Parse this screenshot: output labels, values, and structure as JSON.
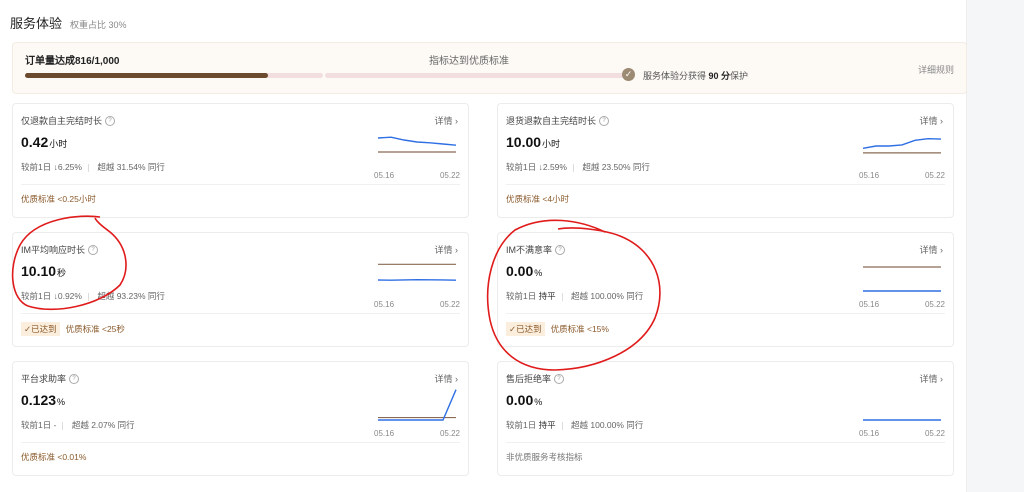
{
  "section": {
    "title": "服务体验",
    "weight": "权重占比 30%"
  },
  "progress": {
    "label": "订单量达成816/1,000",
    "middle": "指标达到优质标准",
    "protect_prefix": "服务体验分获得",
    "protect_score": "90 分",
    "protect_suffix": "保护",
    "rules": "详细规则",
    "orders_done": 816,
    "orders_target": 1000,
    "shield_icon": "shield-check-icon"
  },
  "detail_label": "详情 ›",
  "cards": [
    {
      "title": "仅退款自主完结时长",
      "value": "0.42",
      "unit": "小时",
      "cmp_label": "较前1日",
      "cmp_dir": "↓",
      "cmp_val": "6.25%",
      "beat": "超越 31.54% 同行",
      "achieved": "",
      "standard": "优质标准 <0.25小时",
      "d1": "05.16",
      "d2": "05.22",
      "trend": [
        0.6,
        0.62,
        0.55,
        0.5,
        0.48,
        0.45,
        0.42
      ],
      "baseline": 0.25,
      "ymax": 0.8
    },
    {
      "title": "退货退款自主完结时长",
      "value": "10.00",
      "unit": "小时",
      "cmp_label": "较前1日",
      "cmp_dir": "↓",
      "cmp_val": "2.59%",
      "beat": "超越 23.50% 同行",
      "achieved": "",
      "standard": "优质标准 <4小时",
      "d1": "05.16",
      "d2": "05.22",
      "trend": [
        6,
        7,
        7,
        7.5,
        9.5,
        10.2,
        10
      ],
      "baseline": 4,
      "ymax": 14
    },
    {
      "title": "IM平均响应时长",
      "value": "10.10",
      "unit": "秒",
      "cmp_label": "较前1日",
      "cmp_dir": "↓",
      "cmp_val": "0.92%",
      "beat": "超越 93.23% 同行",
      "achieved": "✓已达到",
      "standard": "优质标准 <25秒",
      "d1": "05.16",
      "d2": "05.22",
      "trend": [
        10.3,
        10.1,
        10.4,
        10.6,
        10.5,
        10.4,
        10.1
      ],
      "baseline": 25,
      "ymax": 30
    },
    {
      "title": "IM不满意率",
      "value": "0.00",
      "unit": "%",
      "cmp_label": "较前1日",
      "cmp_dir": "",
      "cmp_val": "持平",
      "beat": "超越 100.00% 同行",
      "achieved": "✓已达到",
      "standard": "优质标准 <15%",
      "d1": "05.16",
      "d2": "05.22",
      "trend": [
        0,
        0,
        0,
        0,
        0,
        0,
        0
      ],
      "baseline": 15,
      "ymax": 20
    },
    {
      "title": "平台求助率",
      "value": "0.123",
      "unit": "%",
      "cmp_label": "较前1日",
      "cmp_dir": "",
      "cmp_val": "-",
      "beat": "超越 2.07% 同行",
      "achieved": "",
      "standard": "优质标准 <0.01%",
      "d1": "05.16",
      "d2": "05.22",
      "trend": [
        0,
        0,
        0,
        0,
        0,
        0,
        0.123
      ],
      "baseline": 0.01,
      "ymax": 0.13
    },
    {
      "title": "售后拒绝率",
      "value": "0.00",
      "unit": "%",
      "cmp_label": "较前1日",
      "cmp_dir": "",
      "cmp_val": "持平",
      "beat": "超越 100.00% 同行",
      "achieved": "",
      "standard": "非优质服务考核指标",
      "d1": "05.16",
      "d2": "05.22",
      "trend": [
        0,
        0,
        0,
        0,
        0,
        0,
        0
      ],
      "baseline": null,
      "ymax": 1
    }
  ],
  "colors": {
    "trend": "#2f6fe4",
    "baseline": "#8a6a55",
    "annotation": "#e01b1b"
  }
}
